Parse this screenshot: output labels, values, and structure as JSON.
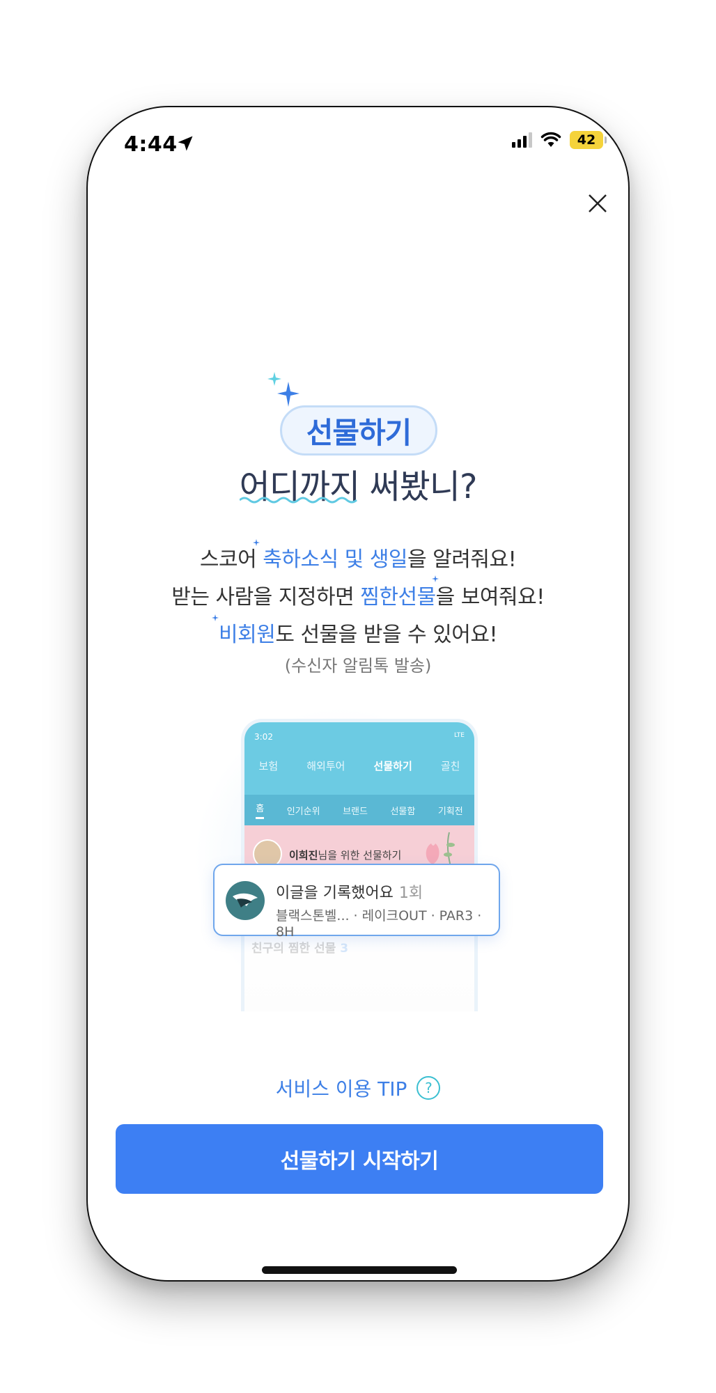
{
  "status": {
    "time": "4:44",
    "battery": "42"
  },
  "hero": {
    "pill": "선물하기",
    "headline": "어디까지 써봤니?"
  },
  "features": [
    {
      "pre": "스코어 ",
      "hl": "축하소식 및 생일",
      "post": "을 알려줘요!"
    },
    {
      "pre": "받는 사람을 지정하면 ",
      "hl": "찜한선물",
      "post": "을 보여줘요!"
    },
    {
      "pre": "",
      "hl": "비회원",
      "post": "도 선물을 받을 수 있어요!"
    }
  ],
  "features_note": "(수신자 알림톡 발송)",
  "mockup": {
    "time": "3:02",
    "signal": "LTE",
    "tabs": [
      "보험",
      "해외투어",
      "선물하기",
      "골친"
    ],
    "subtabs": [
      "홈",
      "인기순위",
      "브랜드",
      "선물함",
      "기획전"
    ],
    "banner_name": "이희진",
    "banner_suffix": "님을 위한 선물하기",
    "wishlist_label": "친구의 찜한 선물",
    "wishlist_count": "3"
  },
  "notification": {
    "title": "이글을 기록했어요",
    "count": "1회",
    "subtitle": "블랙스톤벨... · 레이크OUT · PAR3 · 8H"
  },
  "tip": {
    "label": "서비스 이용 TIP",
    "icon": "?"
  },
  "cta": {
    "label": "선물하기 시작하기"
  }
}
